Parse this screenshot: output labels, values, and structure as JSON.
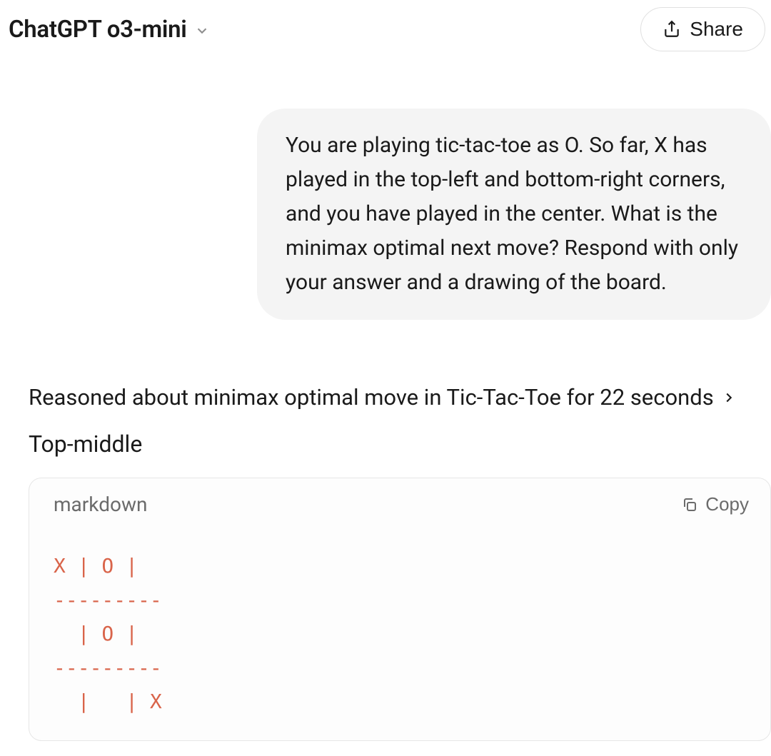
{
  "header": {
    "model_name": "ChatGPT o3-mini",
    "share_label": "Share"
  },
  "conversation": {
    "user_message": "You are playing tic-tac-toe as O. So far, X has played in the top-left and bottom-right corners, and you have played in the center. What is the minimax optimal next move? Respond with only your answer and a drawing of the board.",
    "reasoning_summary": "Reasoned about minimax optimal move in Tic-Tac-Toe for 22 seconds",
    "answer_text": "Top-middle",
    "code_block": {
      "language": "markdown",
      "copy_label": "Copy",
      "content": "X | O |  \n---------\n  | O |  \n---------\n  |   | X"
    }
  }
}
